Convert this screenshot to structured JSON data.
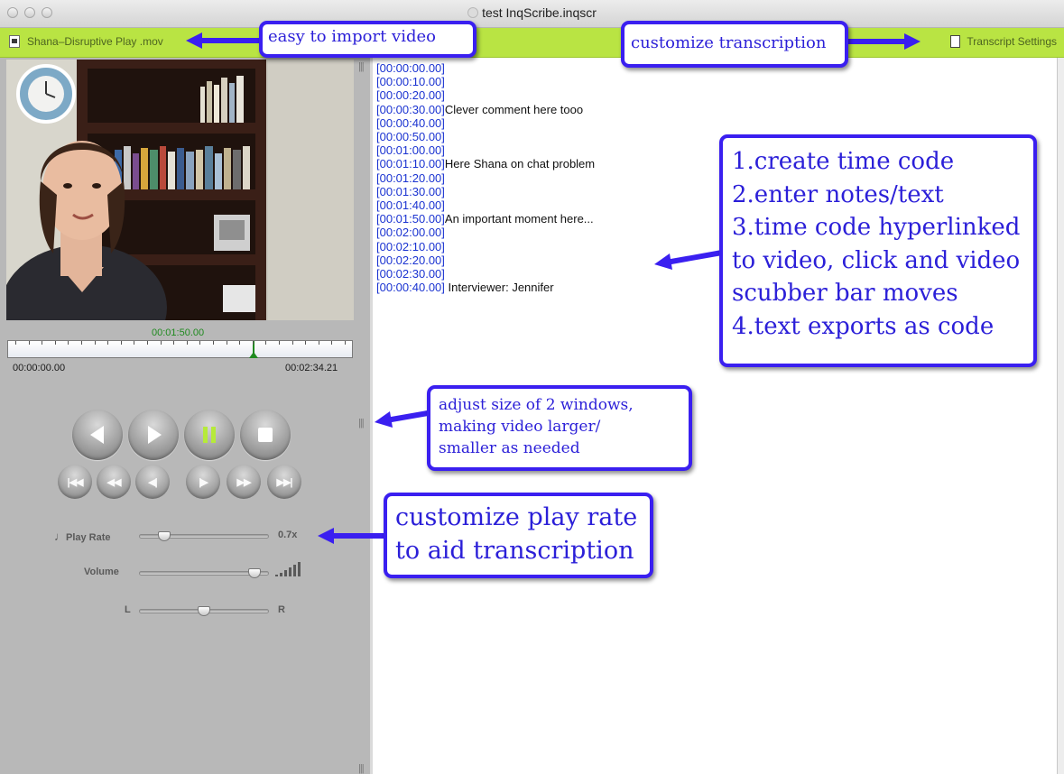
{
  "window": {
    "title": "test InqScribe.inqscr"
  },
  "toolbar": {
    "media_file": "Shana–Disruptive Play .mov",
    "transcript_settings": "Transcript Settings"
  },
  "player": {
    "current_time": "00:01:50.00",
    "start_time": "00:00:00.00",
    "end_time": "00:02:34.21",
    "playhead_fraction": 0.7135,
    "play_rate_label": "Play Rate",
    "play_rate_value": "0.7x",
    "play_rate_fraction": 0.16,
    "volume_label": "Volume",
    "volume_fraction": 0.93,
    "balance_left": "L",
    "balance_right": "R",
    "balance_fraction": 0.5
  },
  "transcript": {
    "lines": [
      {
        "tc": "[00:00:00.00]",
        "text": ""
      },
      {
        "tc": "[00:00:10.00]",
        "text": ""
      },
      {
        "tc": "[00:00:20.00]",
        "text": ""
      },
      {
        "tc": "[00:00:30.00]",
        "text": "Clever comment here tooo"
      },
      {
        "tc": "[00:00:40.00]",
        "text": ""
      },
      {
        "tc": "[00:00:50.00]",
        "text": ""
      },
      {
        "tc": "[00:01:00.00]",
        "text": ""
      },
      {
        "tc": "[00:01:10.00]",
        "text": "Here Shana on chat problem"
      },
      {
        "tc": "[00:01:20.00]",
        "text": ""
      },
      {
        "tc": "[00:01:30.00]",
        "text": ""
      },
      {
        "tc": "[00:01:40.00]",
        "text": ""
      },
      {
        "tc": "[00:01:50.00]",
        "text": "An important moment here..."
      },
      {
        "tc": "[00:02:00.00]",
        "text": ""
      },
      {
        "tc": "[00:02:10.00]",
        "text": ""
      },
      {
        "tc": "[00:02:20.00]",
        "text": ""
      },
      {
        "tc": "[00:02:30.00]",
        "text": ""
      },
      {
        "tc": "[00:00:40.00]",
        "text": " Interviewer: Jennifer"
      }
    ]
  },
  "callouts": {
    "import": "easy to import video",
    "customize": "customize transcription",
    "steps": [
      "1.create time code",
      "2.enter notes/text",
      "3.time code hyperlinked",
      "to video, click and video",
      "scubber bar moves",
      "4.text exports as code"
    ],
    "resize": [
      "adjust size of 2 windows,",
      "making video larger/",
      "smaller as needed"
    ],
    "playrate": [
      "customize play rate",
      "to aid transcription"
    ]
  },
  "colors": {
    "toolbar_green": "#b9e443",
    "timecode_blue": "#1a33d1",
    "callout_border": "#3a1ff0",
    "playhead_green": "#1f8a1f"
  }
}
